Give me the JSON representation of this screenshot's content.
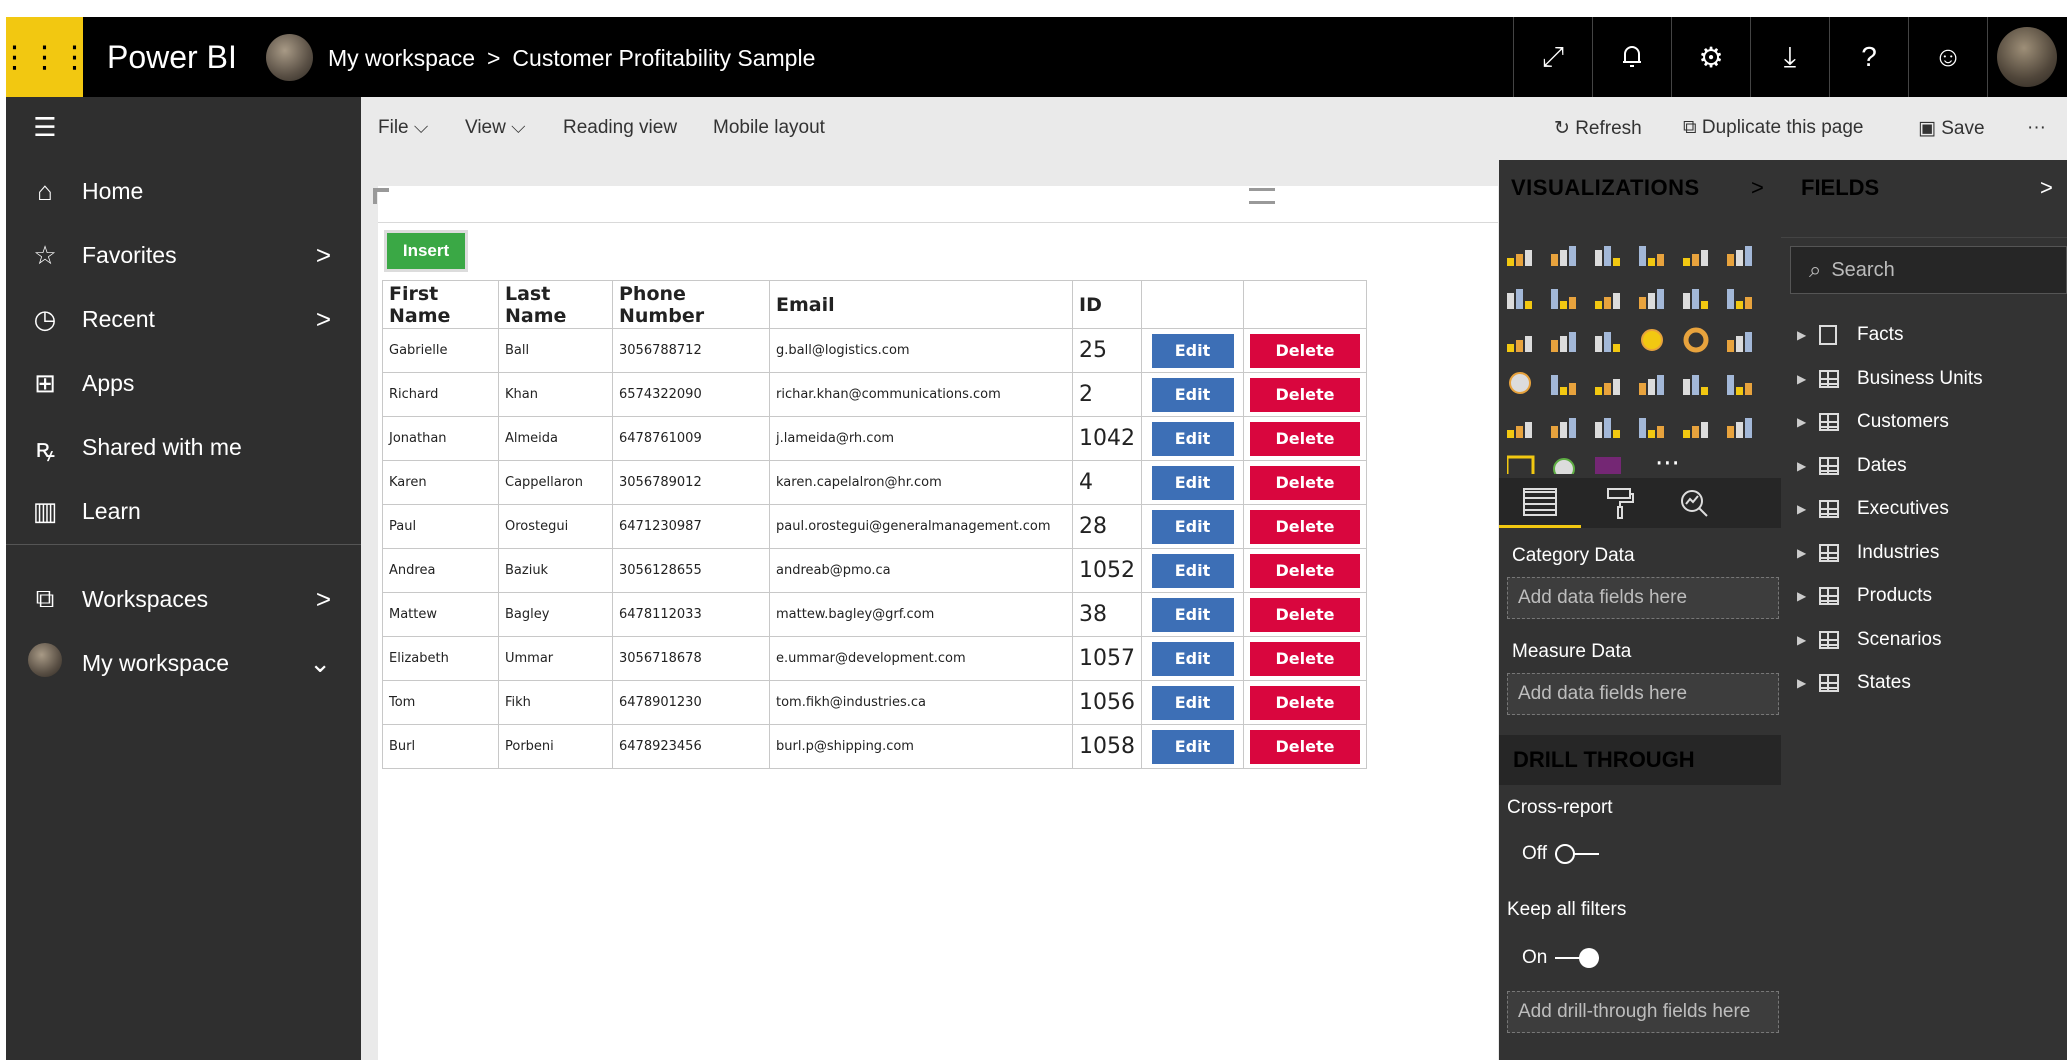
{
  "app": {
    "brand": "Power BI",
    "breadcrumb": {
      "workspace": "My workspace",
      "separator": ">",
      "report": "Customer Profitability Sample"
    },
    "top_icons": [
      "expand-icon",
      "notification-bell-icon",
      "settings-gear-icon",
      "download-icon",
      "help-icon",
      "feedback-smiley-icon"
    ]
  },
  "nav": {
    "items": [
      {
        "label": "Home",
        "icon": "home-icon"
      },
      {
        "label": "Favorites",
        "icon": "star-icon",
        "chevron": ">"
      },
      {
        "label": "Recent",
        "icon": "clock-icon",
        "chevron": ">"
      },
      {
        "label": "Apps",
        "icon": "apps-icon"
      },
      {
        "label": "Shared with me",
        "icon": "shared-icon"
      },
      {
        "label": "Learn",
        "icon": "book-icon"
      },
      {
        "label": "Workspaces",
        "icon": "workspaces-icon",
        "chevron": ">"
      },
      {
        "label": "My workspace",
        "icon": "avatar",
        "chevron": "⌄"
      }
    ]
  },
  "menubar": {
    "file": "File",
    "view": "View",
    "reading_view": "Reading view",
    "mobile_layout": "Mobile layout",
    "refresh": "Refresh",
    "duplicate": "Duplicate this page",
    "save": "Save",
    "more": "···"
  },
  "table": {
    "insert_label": "Insert",
    "edit_label": "Edit",
    "delete_label": "Delete",
    "columns": [
      "First Name",
      "Last Name",
      "Phone Number",
      "Email",
      "ID"
    ],
    "rows": [
      [
        "Gabrielle",
        "Ball",
        "3056788712",
        "g.ball@logistics.com",
        "25"
      ],
      [
        "Richard",
        "Khan",
        "6574322090",
        "richar.khan@communications.com",
        "2"
      ],
      [
        "Jonathan",
        "Almeida",
        "6478761009",
        "j.lameida@rh.com",
        "1042"
      ],
      [
        "Karen",
        "Cappellaron",
        "3056789012",
        "karen.capelalron@hr.com",
        "4"
      ],
      [
        "Paul",
        "Orostegui",
        "6471230987",
        "paul.orostegui@generalmanagement.com",
        "28"
      ],
      [
        "Andrea",
        "Baziuk",
        "3056128655",
        "andreab@pmo.ca",
        "1052"
      ],
      [
        "Mattew",
        "Bagley",
        "6478112033",
        "mattew.bagley@grf.com",
        "38"
      ],
      [
        "Elizabeth",
        "Ummar",
        "3056718678",
        "e.ummar@development.com",
        "1057"
      ],
      [
        "Tom",
        "Fikh",
        "6478901230",
        "tom.fikh@industries.ca",
        "1056"
      ],
      [
        "Burl",
        "Porbeni",
        "6478923456",
        "burl.p@shipping.com",
        "1058"
      ]
    ]
  },
  "viz": {
    "title": "VISUALIZATIONS",
    "collapse": ">",
    "more": "···",
    "category_label": "Category Data",
    "measure_label": "Measure Data",
    "well_placeholder": "Add data fields here",
    "drill_title": "DRILL THROUGH",
    "cross_report_label": "Cross-report",
    "cross_report_state": "Off",
    "keep_filters_label": "Keep all filters",
    "keep_filters_state": "On",
    "drill_placeholder": "Add drill-through fields here"
  },
  "fields": {
    "title": "FIELDS",
    "collapse": ">",
    "search_placeholder": "Search",
    "items": [
      "Facts",
      "Business Units",
      "Customers",
      "Dates",
      "Executives",
      "Industries",
      "Products",
      "Scenarios",
      "States"
    ]
  },
  "colors": {
    "accent": "#f2c811",
    "insert_green": "#3aa845",
    "edit_blue": "#3d6fb6",
    "delete_red": "#d9063e",
    "pane_dark": "#333333"
  }
}
